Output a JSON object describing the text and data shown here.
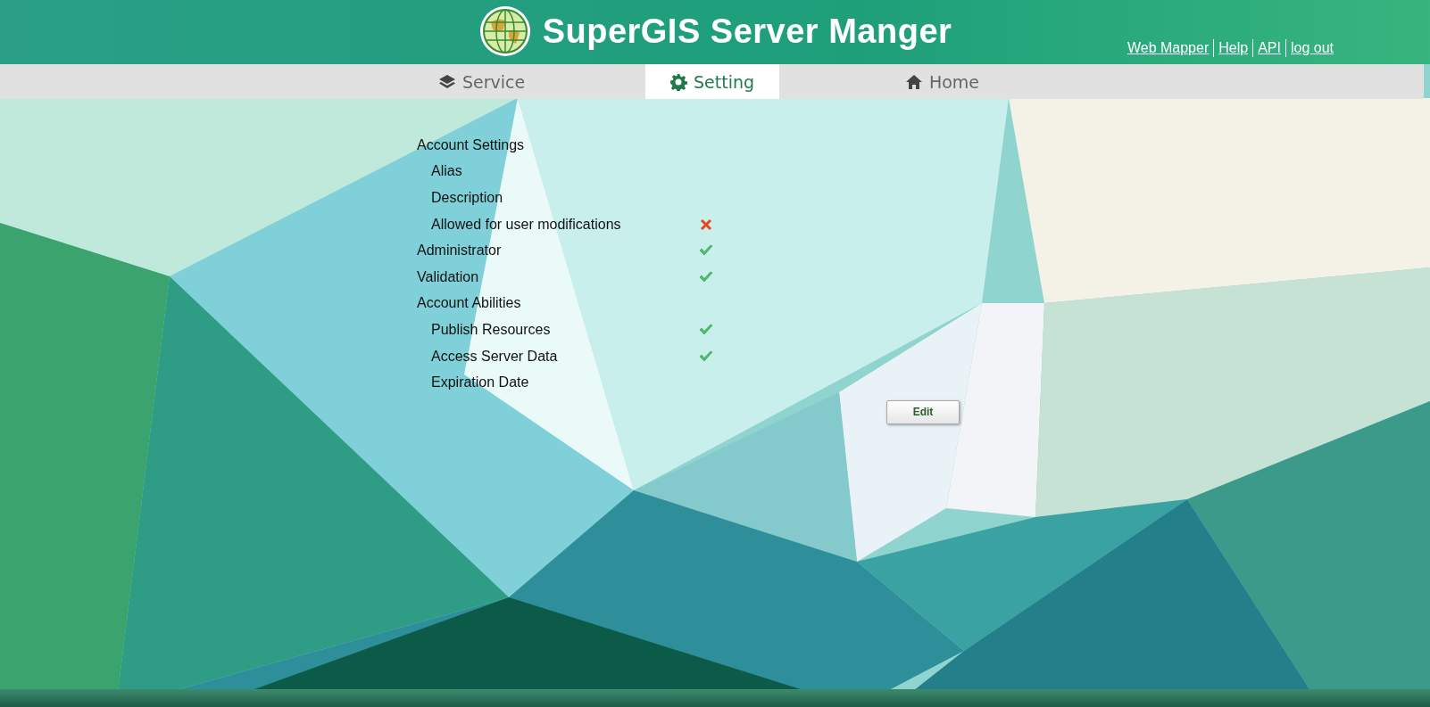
{
  "header": {
    "title": "SuperGIS Server Manger",
    "links": [
      {
        "label": "Web Mapper"
      },
      {
        "label": "Help"
      },
      {
        "label": "API"
      },
      {
        "label": "log out"
      }
    ]
  },
  "tabs": [
    {
      "label": "Service",
      "selected": false
    },
    {
      "label": "Setting",
      "selected": true
    },
    {
      "label": "Home",
      "selected": false
    }
  ],
  "settings": [
    {
      "label": "Account Settings",
      "children": [
        {
          "label": "Alias"
        },
        {
          "label": "Description"
        },
        {
          "label": "Allowed for user modifications",
          "allowed": false
        }
      ]
    },
    {
      "label": "Administrator",
      "allowed": true
    },
    {
      "label": "Validation",
      "allowed": true
    },
    {
      "label": "Account Abilities",
      "children": [
        {
          "label": "Publish Resources",
          "allowed": true
        },
        {
          "label": "Access Server Data",
          "allowed": true
        },
        {
          "label": "Expiration Date"
        }
      ]
    }
  ],
  "edit_button": "Edit"
}
